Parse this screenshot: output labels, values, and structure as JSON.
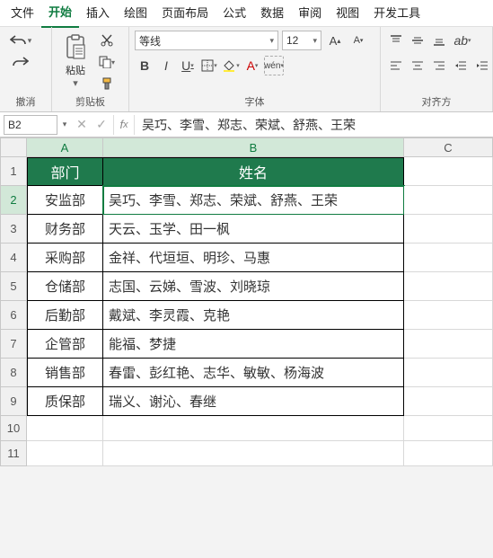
{
  "menu": {
    "items": [
      "文件",
      "开始",
      "插入",
      "绘图",
      "页面布局",
      "公式",
      "数据",
      "审阅",
      "视图",
      "开发工具"
    ],
    "active": 1
  },
  "ribbon": {
    "undo_group": "撤消",
    "clipboard_group": "剪贴板",
    "paste_label": "粘贴",
    "font_group": "字体",
    "align_group": "对齐方",
    "font_name": "等线",
    "font_size": "12"
  },
  "formula_bar": {
    "cell_ref": "B2",
    "value": "吴巧、李雪、郑志、荣斌、舒燕、王荣"
  },
  "columns": [
    "A",
    "B",
    "C"
  ],
  "chart_data": {
    "type": "table",
    "headers": [
      "部门",
      "姓名"
    ],
    "rows": [
      [
        "安监部",
        "吴巧、李雪、郑志、荣斌、舒燕、王荣"
      ],
      [
        "财务部",
        "天云、玉学、田一枫"
      ],
      [
        "采购部",
        "金祥、代垣垣、明珍、马惠"
      ],
      [
        "仓储部",
        "志国、云娣、雪波、刘晓琼"
      ],
      [
        "后勤部",
        "戴斌、李灵霞、克艳"
      ],
      [
        "企管部",
        "能福、梦捷"
      ],
      [
        "销售部",
        "春雷、彭红艳、志华、敏敏、杨海波"
      ],
      [
        "质保部",
        "瑞义、谢沁、春继"
      ]
    ]
  },
  "empty_rows": [
    "10",
    "11"
  ]
}
